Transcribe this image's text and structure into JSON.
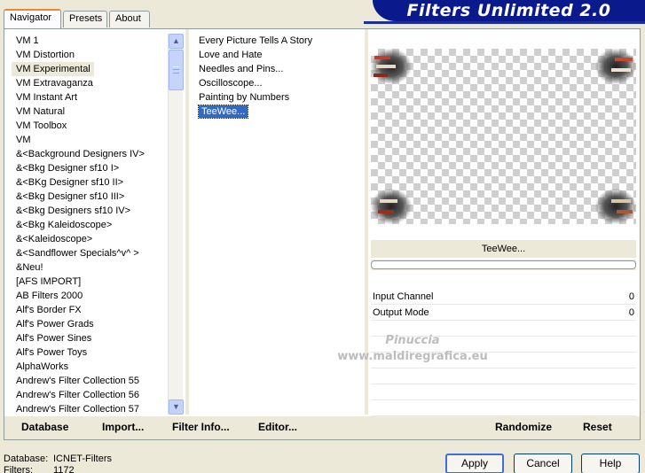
{
  "tabs": [
    {
      "label": "Navigator",
      "active": true
    },
    {
      "label": "Presets",
      "active": false
    },
    {
      "label": "About",
      "active": false
    }
  ],
  "app_title": "Filters Unlimited 2.0",
  "categories": [
    {
      "label": "VM 1",
      "selected": false
    },
    {
      "label": "VM Distortion",
      "selected": false
    },
    {
      "label": "VM Experimental",
      "selected": true
    },
    {
      "label": "VM Extravaganza",
      "selected": false
    },
    {
      "label": "VM Instant Art",
      "selected": false
    },
    {
      "label": "VM Natural",
      "selected": false
    },
    {
      "label": "VM Toolbox",
      "selected": false
    },
    {
      "label": "VM",
      "selected": false
    },
    {
      "label": "&<Background Designers IV>",
      "selected": false
    },
    {
      "label": "&<Bkg Designer sf10 I>",
      "selected": false
    },
    {
      "label": "&<BKg Designer sf10 II>",
      "selected": false
    },
    {
      "label": "&<Bkg Designer sf10 III>",
      "selected": false
    },
    {
      "label": "&<Bkg Designers sf10 IV>",
      "selected": false
    },
    {
      "label": "&<Bkg Kaleidoscope>",
      "selected": false
    },
    {
      "label": "&<Kaleidoscope>",
      "selected": false
    },
    {
      "label": "&<Sandflower Specials^v^ >",
      "selected": false
    },
    {
      "label": "&Neu!",
      "selected": false
    },
    {
      "label": "[AFS IMPORT]",
      "selected": false
    },
    {
      "label": "AB Filters 2000",
      "selected": false
    },
    {
      "label": "Alf's Border FX",
      "selected": false
    },
    {
      "label": "Alf's Power Grads",
      "selected": false
    },
    {
      "label": "Alf's Power Sines",
      "selected": false
    },
    {
      "label": "Alf's Power Toys",
      "selected": false
    },
    {
      "label": "AlphaWorks",
      "selected": false
    },
    {
      "label": "Andrew's Filter Collection 55",
      "selected": false
    },
    {
      "label": "Andrew's Filter Collection 56",
      "selected": false
    },
    {
      "label": "Andrew's Filter Collection 57",
      "selected": false
    }
  ],
  "filters": [
    {
      "label": "Every Picture Tells A Story",
      "selected": false
    },
    {
      "label": "Love and Hate",
      "selected": false
    },
    {
      "label": "Needles and Pins...",
      "selected": false
    },
    {
      "label": "Oscilloscope...",
      "selected": false
    },
    {
      "label": "Painting by Numbers",
      "selected": false
    },
    {
      "label": "TeeWee...",
      "selected": true
    }
  ],
  "preview": {
    "filter_name": "TeeWee...",
    "progress": 0
  },
  "params": [
    {
      "label": "Input Channel",
      "value": "0"
    },
    {
      "label": "Output Mode",
      "value": "0"
    }
  ],
  "watermark": {
    "line1": "Pinuccia",
    "line2": "www.maldiregrafica.eu"
  },
  "bottom_buttons": {
    "database": "Database",
    "import": "Import...",
    "filter_info": "Filter Info...",
    "editor": "Editor...",
    "randomize": "Randomize",
    "reset": "Reset"
  },
  "footer": {
    "database_label": "Database:",
    "database_value": "ICNET-Filters",
    "filters_label": "Filters:",
    "filters_value": "1172"
  },
  "dialog_buttons": {
    "apply": "Apply",
    "cancel": "Cancel",
    "help": "Help"
  },
  "colors": {
    "banner": "#0a1a8c",
    "selection": "#316ac5",
    "panel": "#ece9d8"
  }
}
